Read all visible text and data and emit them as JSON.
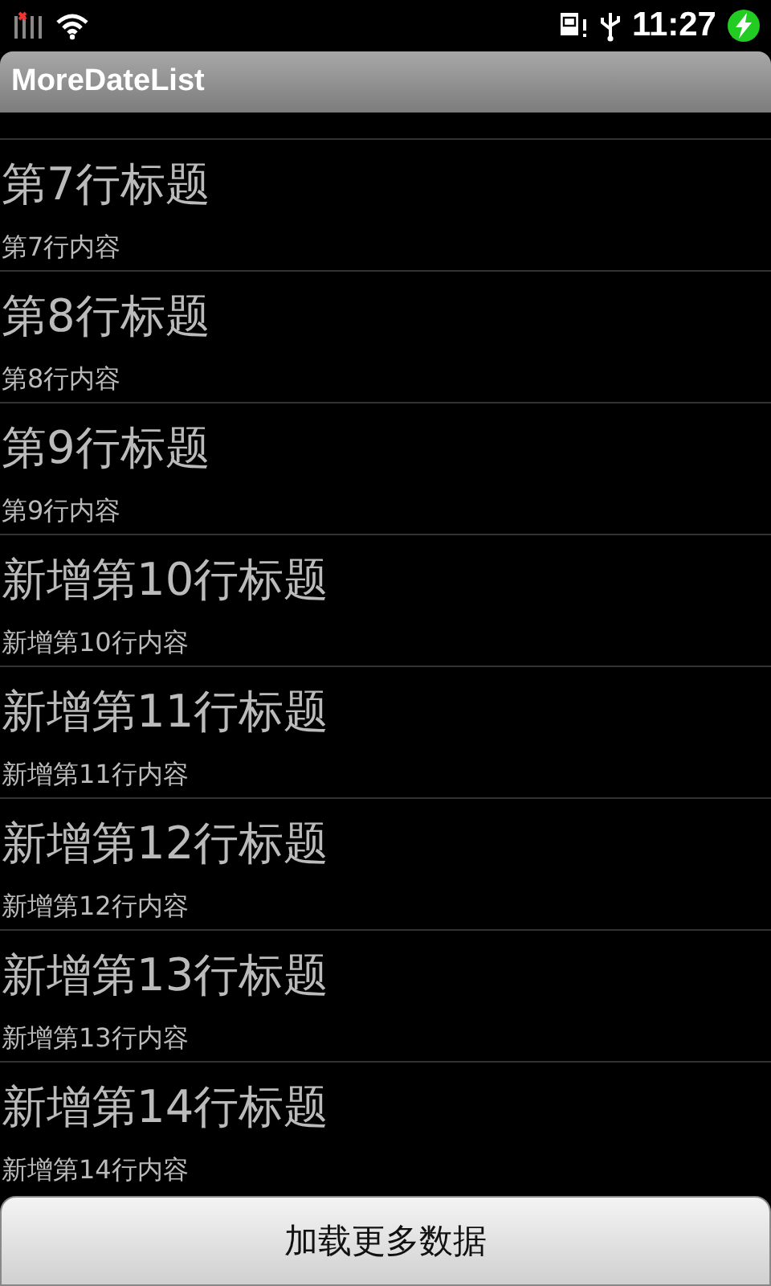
{
  "status_bar": {
    "time": "11:27"
  },
  "app_bar": {
    "title": "MoreDateList"
  },
  "rows": [
    {
      "title": "第7行标题",
      "content": "第7行内容"
    },
    {
      "title": "第8行标题",
      "content": "第8行内容"
    },
    {
      "title": "第9行标题",
      "content": "第9行内容"
    },
    {
      "title": "新增第10行标题",
      "content": "新增第10行内容"
    },
    {
      "title": "新增第11行标题",
      "content": "新增第11行内容"
    },
    {
      "title": "新增第12行标题",
      "content": "新增第12行内容"
    },
    {
      "title": "新增第13行标题",
      "content": "新增第13行内容"
    },
    {
      "title": "新增第14行标题",
      "content": "新增第14行内容"
    }
  ],
  "load_button": {
    "label": "加载更多数据"
  }
}
